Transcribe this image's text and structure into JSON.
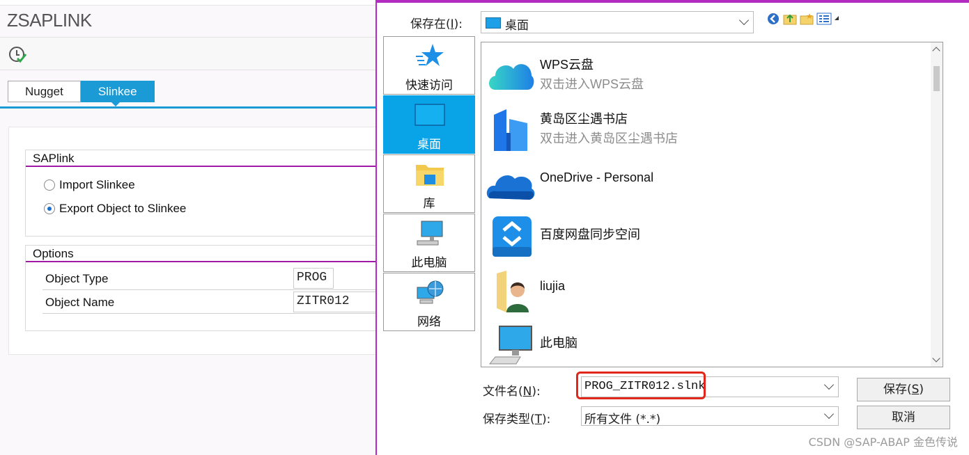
{
  "sap": {
    "title": "ZSAPLINK",
    "tabs": [
      {
        "label": "Nugget",
        "active": false
      },
      {
        "label": "Slinkee",
        "active": true
      }
    ],
    "group1": {
      "title": "SAPlink",
      "radios": [
        {
          "label": "Import Slinkee",
          "selected": false
        },
        {
          "label": "Export Object to Slinkee",
          "selected": true
        }
      ]
    },
    "group2": {
      "title": "Options",
      "fields": [
        {
          "label": "Object Type",
          "value": "PROG"
        },
        {
          "label": "Object Name",
          "value": "ZITR012"
        }
      ]
    },
    "accent_color": "#1a9bd6",
    "group_line_color": "#9e1aa6"
  },
  "dialog": {
    "save_in_label": "保存在(",
    "save_in_key": "I",
    "save_in_tail": "):",
    "save_in_value": "桌面",
    "places": [
      {
        "label": "快速访问",
        "icon": "star-icon",
        "selected": false
      },
      {
        "label": "桌面",
        "icon": "desktop-icon",
        "selected": true
      },
      {
        "label": "库",
        "icon": "library-folder-icon",
        "selected": false
      },
      {
        "label": "此电脑",
        "icon": "computer-icon",
        "selected": false
      },
      {
        "label": "网络",
        "icon": "network-icon",
        "selected": false
      }
    ],
    "items": [
      {
        "name": "WPS云盘",
        "sub": "双击进入WPS云盘",
        "icon": "cloud-icon"
      },
      {
        "name": "黄岛区尘遇书店",
        "sub": "双击进入黄岛区尘遇书店",
        "icon": "building-icon"
      },
      {
        "name": "OneDrive - Personal",
        "sub": "",
        "icon": "onedrive-icon"
      },
      {
        "name": "百度网盘同步空间",
        "sub": "",
        "icon": "baidu-netdisk-icon"
      },
      {
        "name": "liujia",
        "sub": "",
        "icon": "user-folder-icon"
      },
      {
        "name": "此电脑",
        "sub": "",
        "icon": "computer-icon"
      }
    ],
    "filename_label": "文件名(",
    "filename_key": "N",
    "filename_tail": "):",
    "filename_value": "PROG_ZITR012.slnk",
    "filetype_label": "保存类型(",
    "filetype_key": "T",
    "filetype_tail": "):",
    "filetype_value": "所有文件 (*.*)",
    "save_button": "保存(",
    "save_button_key": "S",
    "save_button_tail": ")",
    "cancel_button": "取消",
    "selected_color": "#08a4e7",
    "highlight_color": "#e1261c"
  },
  "watermark": "CSDN @SAP-ABAP 金色传说"
}
